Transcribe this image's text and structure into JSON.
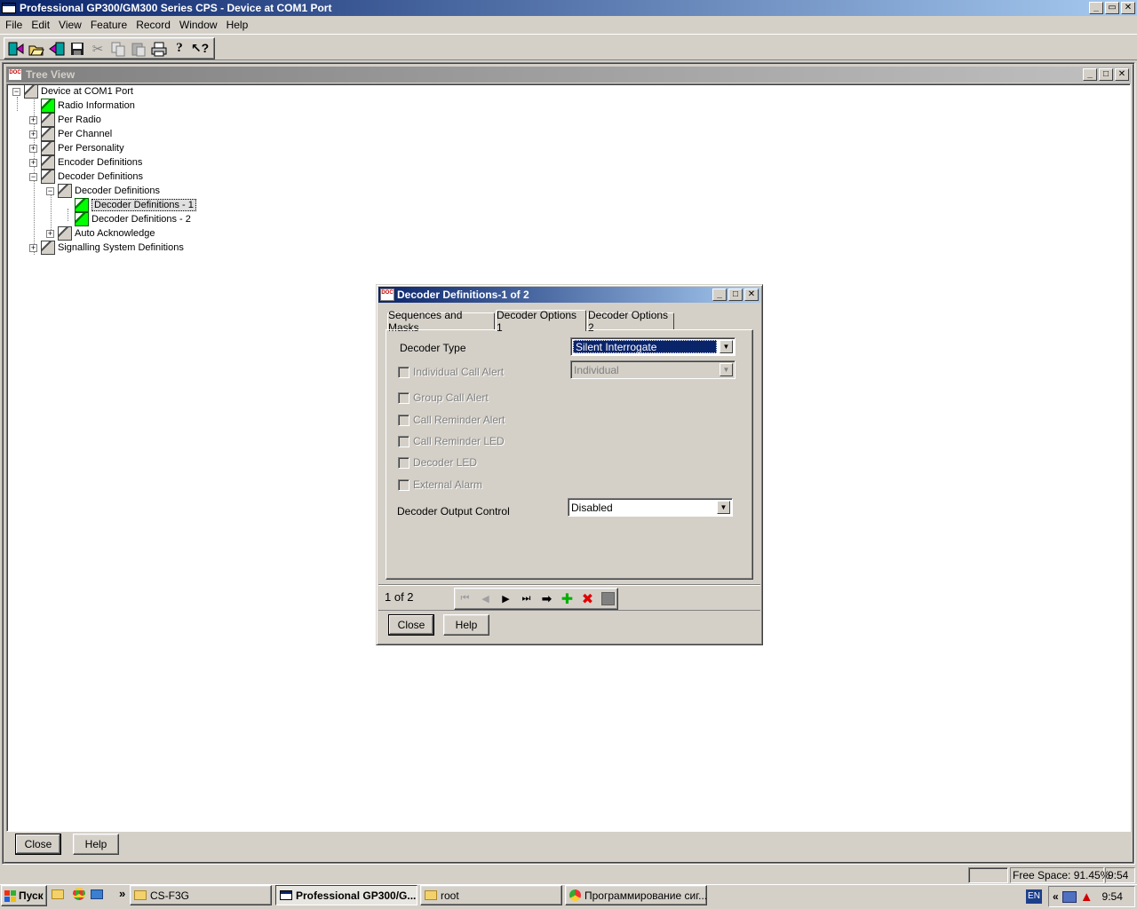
{
  "app": {
    "title": "Professional GP300/GM300 Series CPS - Device at COM1 Port",
    "caption_buttons": [
      "_",
      "▭",
      "✕"
    ]
  },
  "menu": [
    "File",
    "Edit",
    "View",
    "Feature",
    "Record",
    "Window",
    "Help"
  ],
  "toolbar": {
    "icons": [
      "read-radio-icon",
      "open-icon",
      "write-radio-icon",
      "save-icon",
      "cut-icon",
      "copy-icon",
      "paste-icon",
      "print-icon",
      "help-icon",
      "context-help-icon"
    ]
  },
  "tree_window": {
    "title": "Tree View",
    "items": [
      {
        "label": "Device at COM1 Port",
        "expander": "−",
        "icon": "gray"
      },
      {
        "label": "Radio Information",
        "expander": "",
        "icon": "green"
      },
      {
        "label": "Per Radio",
        "expander": "+",
        "icon": "gray"
      },
      {
        "label": "Per Channel",
        "expander": "+",
        "icon": "gray"
      },
      {
        "label": "Per Personality",
        "expander": "+",
        "icon": "gray"
      },
      {
        "label": "Encoder Definitions",
        "expander": "+",
        "icon": "gray"
      },
      {
        "label": "Decoder Definitions",
        "expander": "−",
        "icon": "gray"
      },
      {
        "label": "Decoder Definitions",
        "expander": "−",
        "icon": "gray"
      },
      {
        "label": "Decoder Definitions - 1",
        "expander": "",
        "icon": "green",
        "selected": true
      },
      {
        "label": "Decoder Definitions - 2",
        "expander": "",
        "icon": "green"
      },
      {
        "label": "Auto Acknowledge",
        "expander": "+",
        "icon": "gray"
      },
      {
        "label": "Signalling System Definitions",
        "expander": "+",
        "icon": "gray"
      }
    ],
    "close_label": "Close",
    "help_label": "Help"
  },
  "dialog": {
    "title": "Decoder Definitions-1 of 2",
    "tabs": [
      "Sequences and Masks",
      "Decoder Options 1",
      "Decoder Options 2"
    ],
    "active_tab": "Decoder Options 1",
    "decoder_type_label": "Decoder Type",
    "decoder_type_value": "Silent Interrogate",
    "individual_call_alert_label": "Individual Call Alert",
    "individual_value": "Individual",
    "group_call_alert_label": "Group Call Alert",
    "call_reminder_alert_label": "Call Reminder Alert",
    "call_reminder_led_label": "Call Reminder LED",
    "decoder_led_label": "Decoder LED",
    "external_alarm_label": "External Alarm",
    "decoder_output_label": "Decoder Output Control",
    "decoder_output_value": "Disabled",
    "record_position": "1 of 2",
    "close_label": "Close",
    "help_label": "Help"
  },
  "status": {
    "free_space": "Free Space: 91.45%",
    "time": "9:54"
  },
  "taskbar": {
    "start_label": "Пуск",
    "chevron": "»",
    "tasks": [
      {
        "label": "CS-F3G",
        "icon": "folder"
      },
      {
        "label": "Professional GP300/G...",
        "icon": "app",
        "active": true
      },
      {
        "label": "root",
        "icon": "folder"
      },
      {
        "label": "Программирование сиг...",
        "icon": "chrome"
      }
    ],
    "lang": "EN",
    "tray_chevron": "«",
    "clock": "9:54"
  },
  "colors": {
    "title_active": "#0a246a",
    "title_gradient_end": "#a6caf0",
    "face": "#d4d0c8",
    "selection": "#0a246a"
  }
}
